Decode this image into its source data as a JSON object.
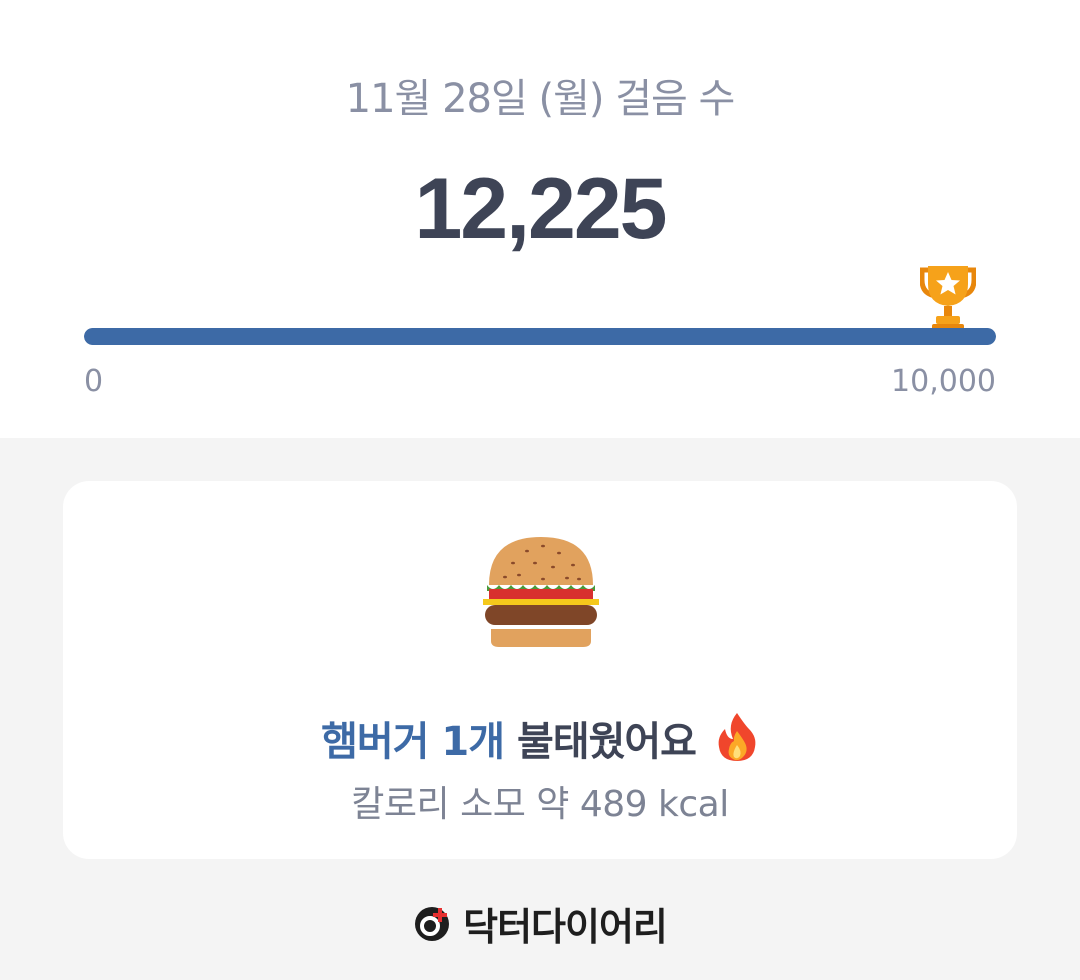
{
  "header": {
    "date_label": "11월 28일 (월) 걸음 수",
    "step_count": "12,225",
    "progress": {
      "current": 12225,
      "goal": 10000,
      "fill_fraction": 1.0,
      "min_label": "0",
      "max_label": "10,000",
      "goal_icon": "trophy-icon"
    }
  },
  "card": {
    "food_icon": "hamburger-icon",
    "burn_highlight": "햄버거 1개",
    "burn_rest": "불태웠어요",
    "burn_icon": "fire-icon",
    "calorie_text": "칼로리 소모 약 489 kcal"
  },
  "footer": {
    "brand_icon": "doctor-diary-logo-icon",
    "brand_name": "닥터다이어리"
  },
  "colors": {
    "accent_blue": "#3d6aa6",
    "text_dark": "#3e4456",
    "text_gray": "#8a90a4",
    "page_bg": "#f4f4f4",
    "card_bg": "#ffffff"
  }
}
